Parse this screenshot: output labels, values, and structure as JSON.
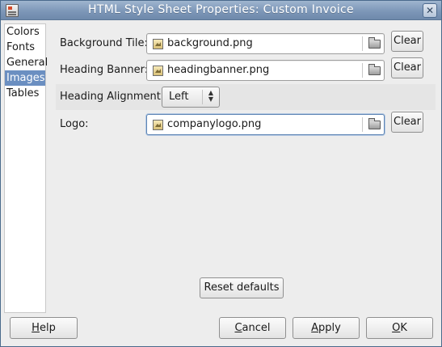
{
  "window": {
    "title": "HTML Style Sheet Properties: Custom Invoice",
    "close_symbol": "✕"
  },
  "sidebar": {
    "items": [
      {
        "label": "Colors",
        "selected": false
      },
      {
        "label": "Fonts",
        "selected": false
      },
      {
        "label": "General",
        "selected": false
      },
      {
        "label": "Images",
        "selected": true
      },
      {
        "label": "Tables",
        "selected": false
      }
    ]
  },
  "images": {
    "background_tile": {
      "label": "Background Tile:",
      "value": "background.png",
      "clear_label": "Clear"
    },
    "heading_banner": {
      "label": "Heading Banner:",
      "value": "headingbanner.png",
      "clear_label": "Clear"
    },
    "heading_alignment": {
      "label": "Heading Alignment:",
      "value": "Left",
      "arrows": "⌃\n⌄"
    },
    "logo": {
      "label": "Logo:",
      "value": "companylogo.png",
      "clear_label": "Clear"
    },
    "reset_label": "Reset defaults"
  },
  "footer": {
    "help": {
      "mnemonic": "H",
      "rest": "elp"
    },
    "cancel": {
      "mnemonic": "C",
      "rest": "ancel"
    },
    "apply": {
      "mnemonic": "A",
      "rest": "pply"
    },
    "ok": {
      "mnemonic": "O",
      "rest": "K"
    }
  },
  "icons": {
    "file": "image-file-icon",
    "folder": "folder-browse-icon",
    "app": "app-icon"
  },
  "colors": {
    "titlebar": "#7d97b8",
    "selection": "#6b8fc1"
  }
}
